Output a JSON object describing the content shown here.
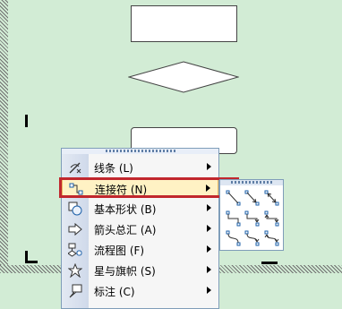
{
  "menu": {
    "items": [
      {
        "label": "线条 (L)",
        "icon": "line-icon",
        "has_submenu": true
      },
      {
        "label": "连接符 (N)",
        "icon": "connector-icon",
        "has_submenu": true,
        "highlighted": true
      },
      {
        "label": "基本形状 (B)",
        "icon": "basic-shapes-icon",
        "has_submenu": true
      },
      {
        "label": "箭头总汇 (A)",
        "icon": "block-arrows-icon",
        "has_submenu": true
      },
      {
        "label": "流程图 (F)",
        "icon": "flowchart-icon",
        "has_submenu": true
      },
      {
        "label": "星与旗帜 (S)",
        "icon": "stars-banners-icon",
        "has_submenu": true
      },
      {
        "label": "标注 (C)",
        "icon": "callouts-icon",
        "has_submenu": true
      }
    ]
  },
  "connector_submenu": {
    "items": [
      {
        "icon": "straight-connector-icon"
      },
      {
        "icon": "straight-arrow-connector-icon"
      },
      {
        "icon": "straight-double-arrow-connector-icon"
      },
      {
        "icon": "elbow-connector-icon"
      },
      {
        "icon": "elbow-arrow-connector-icon"
      },
      {
        "icon": "elbow-double-arrow-connector-icon"
      },
      {
        "icon": "curved-connector-icon"
      },
      {
        "icon": "curved-arrow-connector-icon"
      },
      {
        "icon": "curved-double-arrow-connector-icon"
      }
    ]
  },
  "colors": {
    "canvas_background": "#d2ecd5",
    "highlight_background": "#fff2c4",
    "callout_border": "#c1272d"
  }
}
